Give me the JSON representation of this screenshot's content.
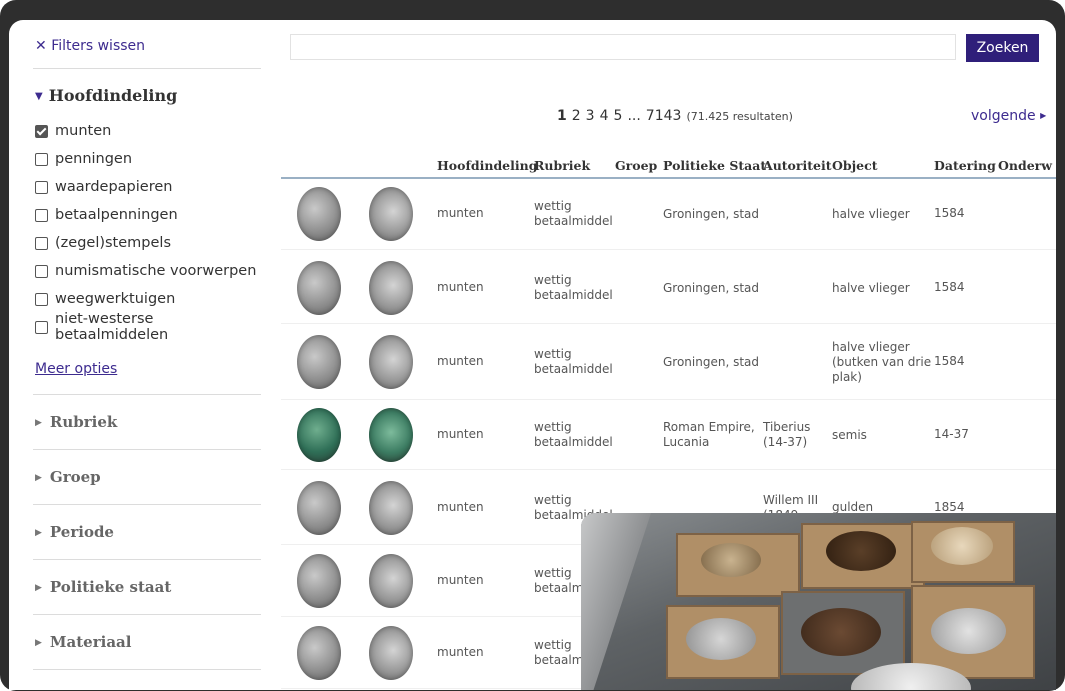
{
  "sidebar": {
    "clear_filters": "Filters wissen",
    "clear_icon": "close-icon",
    "main_facet": {
      "title": "Hoofdindeling",
      "options": [
        {
          "label": "munten",
          "checked": true
        },
        {
          "label": "penningen",
          "checked": false
        },
        {
          "label": "waardepapieren",
          "checked": false
        },
        {
          "label": "betaalpenningen",
          "checked": false
        },
        {
          "label": "(zegel)stempels",
          "checked": false
        },
        {
          "label": "numismatische voorwerpen",
          "checked": false
        },
        {
          "label": "weegwerktuigen",
          "checked": false
        },
        {
          "label": "niet-westerse betaalmiddelen",
          "checked": false
        }
      ],
      "more": "Meer opties"
    },
    "facets": [
      "Rubriek",
      "Groep",
      "Periode",
      "Politieke staat",
      "Materiaal"
    ]
  },
  "search": {
    "value": "",
    "placeholder": "",
    "button": "Zoeken"
  },
  "pagination": {
    "pages": [
      "1",
      "2",
      "3",
      "4",
      "5"
    ],
    "current": "1",
    "ellipsis": "...",
    "last": "7143",
    "results": "(71.425 resultaten)",
    "next": "volgende"
  },
  "table": {
    "columns": [
      "Hoofdindeling",
      "Rubriek",
      "Groep",
      "Politieke Staat",
      "Autoriteit",
      "Object",
      "Datering",
      "Onderw"
    ],
    "rows": [
      {
        "hoofdindeling": "munten",
        "rubriek": [
          "wettig",
          "betaalmiddel"
        ],
        "groep": "",
        "staat": [
          "Groningen, stad"
        ],
        "autoriteit": [],
        "object": [
          "halve vlieger"
        ],
        "datering": "1584",
        "coin": "silver"
      },
      {
        "hoofdindeling": "munten",
        "rubriek": [
          "wettig",
          "betaalmiddel"
        ],
        "groep": "",
        "staat": [
          "Groningen, stad"
        ],
        "autoriteit": [],
        "object": [
          "halve vlieger"
        ],
        "datering": "1584",
        "coin": "silver"
      },
      {
        "hoofdindeling": "munten",
        "rubriek": [
          "wettig",
          "betaalmiddel"
        ],
        "groep": "",
        "staat": [
          "Groningen, stad"
        ],
        "autoriteit": [],
        "object": [
          "halve vlieger",
          "(butken van drie",
          "plak)"
        ],
        "datering": "1584",
        "coin": "silver"
      },
      {
        "hoofdindeling": "munten",
        "rubriek": [
          "wettig",
          "betaalmiddel"
        ],
        "groep": "",
        "staat": [
          "Roman Empire,",
          "Lucania"
        ],
        "autoriteit": [
          "Tiberius",
          "(14-37)"
        ],
        "object": [
          "semis"
        ],
        "datering": "14-37",
        "coin": "green"
      },
      {
        "hoofdindeling": "munten",
        "rubriek": [
          "wettig",
          "betaalmiddel"
        ],
        "groep": "",
        "staat": [],
        "autoriteit": [
          "Willem III",
          "(1849-"
        ],
        "object": [
          "gulden"
        ],
        "datering": "1854",
        "coin": "silver"
      },
      {
        "hoofdindeling": "munten",
        "rubriek": [
          "wettig",
          "betaalm"
        ],
        "groep": "",
        "staat": [],
        "autoriteit": [],
        "object": [],
        "datering": "",
        "coin": "silver"
      },
      {
        "hoofdindeling": "munten",
        "rubriek": [
          "wettig",
          "betaalm"
        ],
        "groep": "",
        "staat": [],
        "autoriteit": [],
        "object": [],
        "datering": "",
        "coin": "silver"
      }
    ]
  }
}
